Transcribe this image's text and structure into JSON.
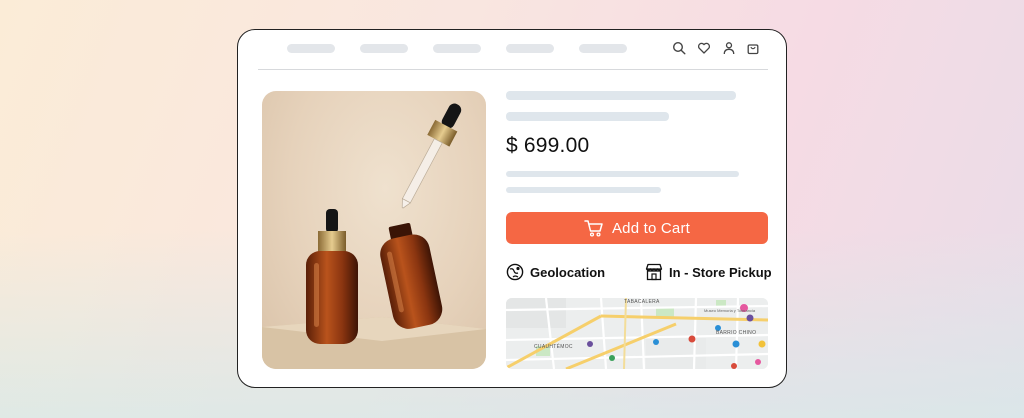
{
  "colors": {
    "accent": "#f56744",
    "skeleton": "#dfe6ec",
    "border": "#222222"
  },
  "header": {
    "nav_items": [
      "placeholder-1",
      "placeholder-2",
      "placeholder-3",
      "placeholder-4",
      "placeholder-5"
    ],
    "icons": [
      "search-icon",
      "heart-icon",
      "user-icon",
      "bag-icon"
    ]
  },
  "product": {
    "price": "$ 699.00",
    "add_to_cart_label": "Add to Cart",
    "features": [
      {
        "icon": "geolocation-icon",
        "label": "Geolocation"
      },
      {
        "icon": "store-icon",
        "label": "In - Store Pickup"
      }
    ]
  },
  "map": {
    "labels": [
      "TABACALERA",
      "BARRIO CHINO",
      "CUAUHTÉMOC",
      "Museo Memoria y Tolerancia"
    ]
  }
}
